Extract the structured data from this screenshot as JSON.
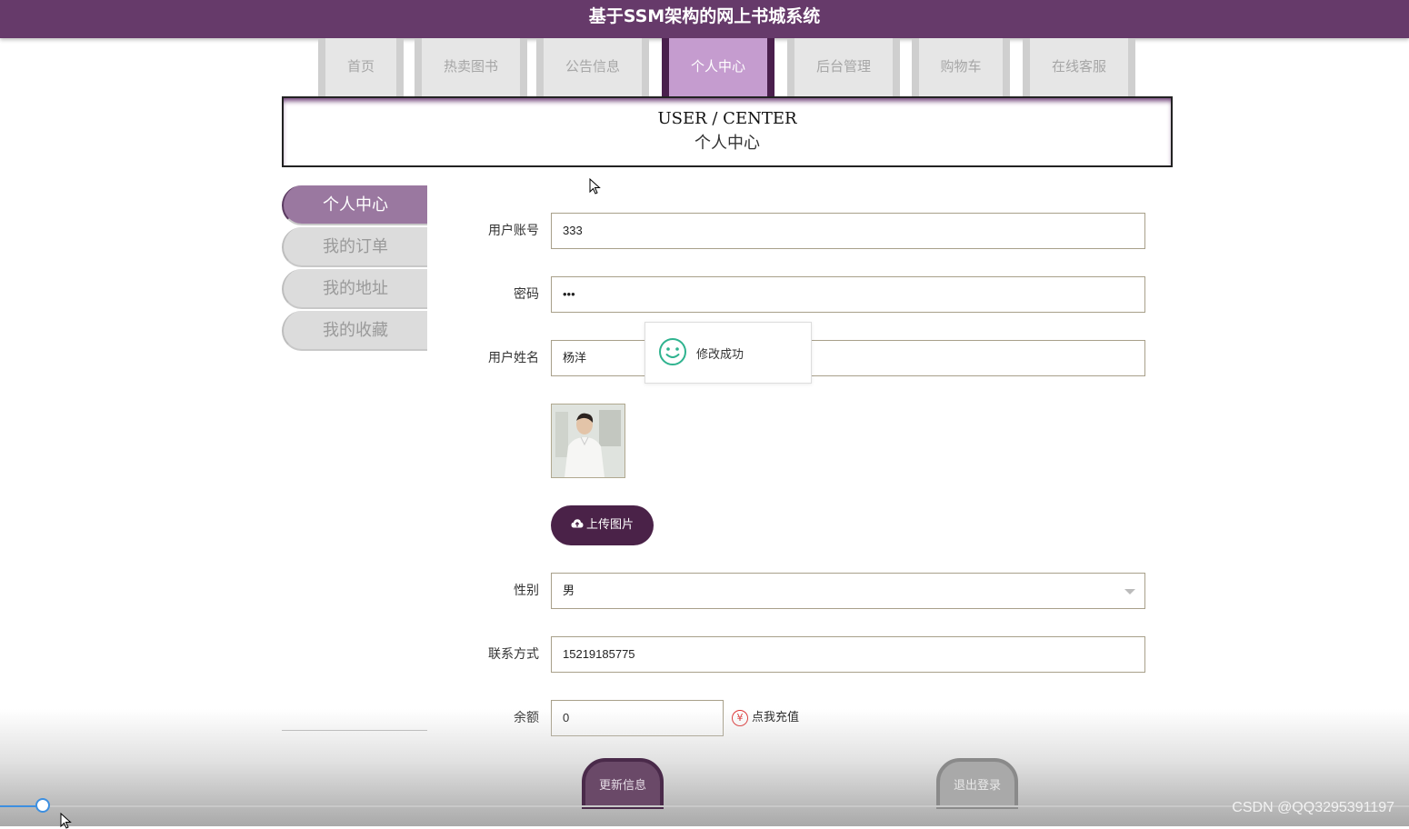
{
  "header": {
    "title": "基于SSM架构的网上书城系统"
  },
  "nav": [
    {
      "label": "首页"
    },
    {
      "label": "热卖图书"
    },
    {
      "label": "公告信息"
    },
    {
      "label": "个人中心"
    },
    {
      "label": "后台管理"
    },
    {
      "label": "购物车"
    },
    {
      "label": "在线客服"
    }
  ],
  "banner": {
    "en": "USER / CENTER",
    "cn": "个人中心"
  },
  "sidebar": [
    {
      "label": "个人中心"
    },
    {
      "label": "我的订单"
    },
    {
      "label": "我的地址"
    },
    {
      "label": "我的收藏"
    }
  ],
  "form": {
    "account": {
      "label": "用户账号",
      "value": "333"
    },
    "password": {
      "label": "密码",
      "value": "•••"
    },
    "name": {
      "label": "用户姓名",
      "value": "杨洋"
    },
    "upload_label": "上传图片",
    "gender": {
      "label": "性别",
      "value": "男"
    },
    "phone": {
      "label": "联系方式",
      "value": "15219185775"
    },
    "balance": {
      "label": "余额",
      "value": "0"
    },
    "recharge_label": "点我充值",
    "recharge_symbol": "¥"
  },
  "toast": {
    "message": "修改成功"
  },
  "buttons": {
    "update": "更新信息",
    "logout": "退出登录"
  },
  "watermark": "CSDN @QQ3295391197"
}
